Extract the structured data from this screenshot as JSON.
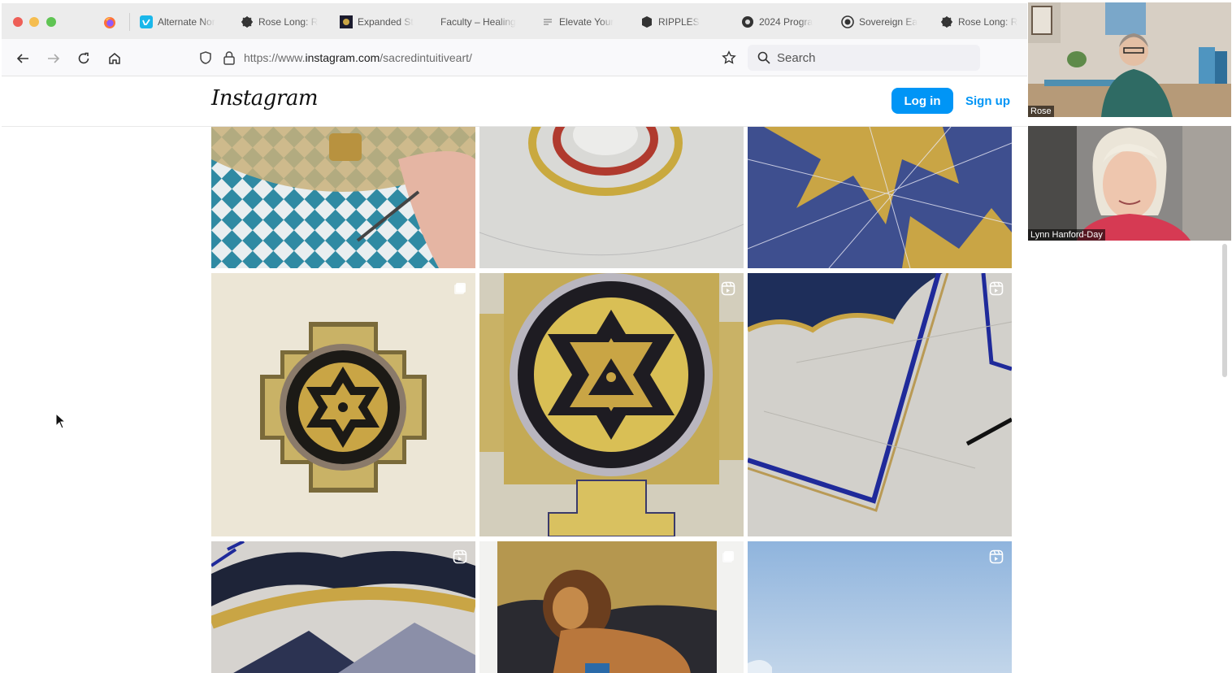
{
  "browser": {
    "tabs": [
      {
        "icon": "vimeo-icon",
        "label": "Alternate Nor"
      },
      {
        "icon": "mandala-icon",
        "label": "Rose Long: R"
      },
      {
        "icon": "expanded-icon",
        "label": "Expanded St"
      },
      {
        "icon": "none",
        "label": "Faculty – Healing"
      },
      {
        "icon": "page-icon",
        "label": "Elevate Your"
      },
      {
        "icon": "ripples-icon",
        "label": "RIPPLES"
      },
      {
        "icon": "program-icon",
        "label": "2024 Progra"
      },
      {
        "icon": "globe-icon",
        "label": "Sovereign Ea"
      },
      {
        "icon": "mandala-icon",
        "label": "Rose Long: R"
      }
    ],
    "url_prefix": "https://www.",
    "url_domain": "instagram.com",
    "url_path": "/sacredintuitiveart/",
    "search_label": "Search"
  },
  "instagram": {
    "logo": "Instagram",
    "login_label": "Log in",
    "signup_label": "Sign up",
    "posts": [
      {
        "art": "blue-diamonds",
        "badge": "none"
      },
      {
        "art": "gold-circle",
        "badge": "none"
      },
      {
        "art": "blue-gold-stars",
        "badge": "none"
      },
      {
        "art": "sri-yantra-square",
        "badge": "carousel-icon"
      },
      {
        "art": "sri-yantra-closeup",
        "badge": "reel-icon"
      },
      {
        "art": "blue-lines",
        "badge": "reel-icon"
      },
      {
        "art": "black-arcs",
        "badge": "reel-icon"
      },
      {
        "art": "lion-painting",
        "badge": "carousel-icon"
      },
      {
        "art": "sky",
        "badge": "reel-icon"
      }
    ]
  },
  "video_call": {
    "participants": [
      {
        "name": "Rose"
      },
      {
        "name": "Lynn Hanford-Day"
      }
    ]
  },
  "colors": {
    "instagram_blue": "#0095f6",
    "tab_bar": "#ececec",
    "gold": "#c9a545",
    "navy": "#1f2a7a"
  }
}
